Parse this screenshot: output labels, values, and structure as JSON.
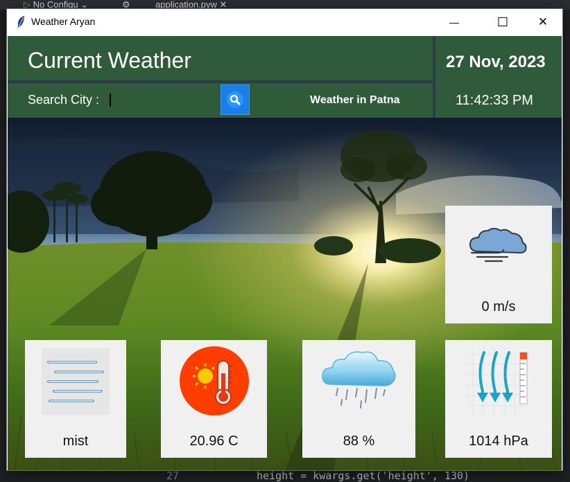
{
  "window": {
    "title": "Weather Aryan",
    "minimize_symbol": "—",
    "maximize_symbol": "☐",
    "close_symbol": "✕"
  },
  "header": {
    "title": "Current Weather",
    "search_label": "Search City :",
    "search_value": "",
    "weather_in": "Weather in Patna",
    "date": "27 Nov, 2023",
    "time": "11:42:33 PM"
  },
  "cards": {
    "wind": {
      "value": "0 m/s",
      "icon": "wind-cloud-icon"
    },
    "description": {
      "value": "mist",
      "icon": "mist-icon"
    },
    "temperature": {
      "value": "20.96 C",
      "icon": "thermometer-sun-icon"
    },
    "humidity": {
      "value": "88 %",
      "icon": "rain-cloud-icon"
    },
    "pressure": {
      "value": "1014 hPa",
      "icon": "pressure-gauge-icon"
    }
  },
  "ide_background": {
    "tab1": "No Configu",
    "tab2": "application.pyw",
    "line_number": "27",
    "code_line": "height = kwargs.get('height', 130)"
  },
  "colors": {
    "header_green": "#2f5b3a",
    "separator": "#2a3c47",
    "search_button_blue": "#1a7fe6",
    "card_bg": "#f0f0f0"
  }
}
